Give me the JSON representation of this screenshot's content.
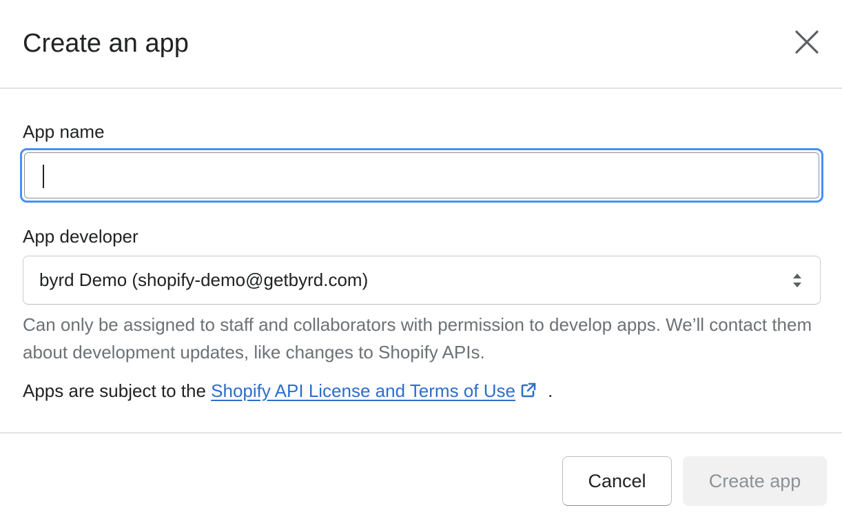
{
  "dialog": {
    "title": "Create an app",
    "close_icon": "close-icon"
  },
  "form": {
    "app_name": {
      "label": "App name",
      "value": "",
      "placeholder": ""
    },
    "app_developer": {
      "label": "App developer",
      "selected": "byrd Demo (shopify-demo@getbyrd.com)",
      "arrow_icon": "select-arrows-icon",
      "help_text": "Can only be assigned to staff and collaborators with permission to develop apps. We’ll contact them about development updates, like changes to Shopify APIs."
    },
    "terms": {
      "prefix": "Apps are subject to the ",
      "link_text": "Shopify API License and Terms of Use",
      "link_icon": "external-link-icon",
      "suffix": "."
    }
  },
  "footer": {
    "cancel_label": "Cancel",
    "create_label": "Create app"
  },
  "colors": {
    "focus_ring": "#458fff",
    "link": "#2c6ecb",
    "help_text": "#6d7175",
    "disabled_bg": "#f1f1f1",
    "disabled_text": "#8c9196"
  }
}
